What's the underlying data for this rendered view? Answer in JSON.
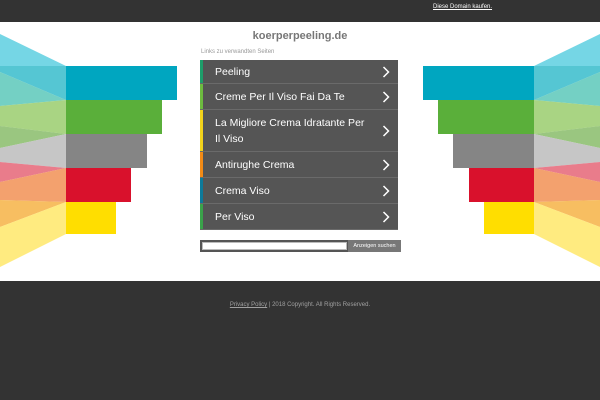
{
  "topbar": {
    "buy_link": "Diese Domain kaufen."
  },
  "domain": {
    "title": "koerperpeeling.de"
  },
  "related": {
    "caption": "Links zu verwandten Seiten",
    "items": [
      {
        "label": "Peeling",
        "accent": "#1e9e6a"
      },
      {
        "label": "Creme Per Il Viso Fai Da Te",
        "accent": "#6dbb3f"
      },
      {
        "label": "La Migliore Crema Idratante Per Il Viso",
        "accent": "#f2d31b"
      },
      {
        "label": "Antirughe Crema",
        "accent": "#f28b16"
      },
      {
        "label": "Crema Viso",
        "accent": "#0d7a9a"
      },
      {
        "label": "Per Viso",
        "accent": "#3aa24a"
      }
    ],
    "chevron_icon": "chevron-right-icon"
  },
  "search": {
    "placeholder": "",
    "button_label": "Anzeigen suchen"
  },
  "footer": {
    "privacy_label": "Privacy Policy",
    "copyright": " | 2018 Copyright. All Rights Reserved."
  },
  "colors": {
    "background_dark": "#333333",
    "content_bg": "#ffffff",
    "list_bg": "#555555",
    "stripe_cyan": "#00a6c0",
    "stripe_green": "#5aaf3a",
    "stripe_gray": "#858585",
    "stripe_red": "#d9112c",
    "stripe_yellow": "#ffde00"
  }
}
